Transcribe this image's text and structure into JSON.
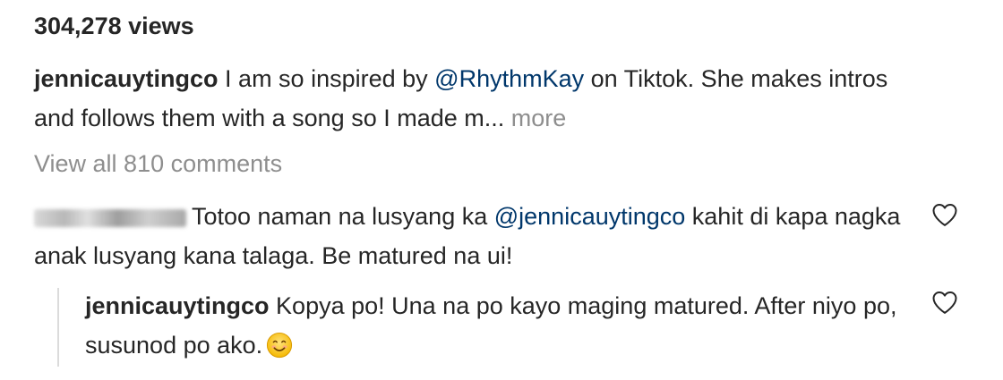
{
  "post": {
    "views": "304,278 views",
    "caption": {
      "username": "jennicauytingco",
      "text_before_mention": " I am so inspired by ",
      "mention": "@RhythmKay",
      "text_after_mention": " on Tiktok. She makes intros and follows them with a song so I made m...",
      "more_label": " more"
    },
    "view_all_comments": "View all 810 comments"
  },
  "comments": [
    {
      "text_before_mention": "Totoo naman na lusyang ka ",
      "mention": "@jennicauytingco",
      "text_after_mention": "  kahit di kapa nagka anak lusyang kana talaga. Be matured na ui!",
      "like_icon": "heart-outline-icon"
    }
  ],
  "reply": {
    "username": "jennicauytingco",
    "text": " Kopya po! Una na po kayo maging matured. After niyo po, susunod po ako.",
    "emoji": "smiling-face-emoji",
    "like_icon": "heart-outline-icon"
  },
  "colors": {
    "text": "#262626",
    "secondary": "#8e8e8e",
    "mention": "#00376b",
    "thread_line": "#dbdbdb"
  }
}
